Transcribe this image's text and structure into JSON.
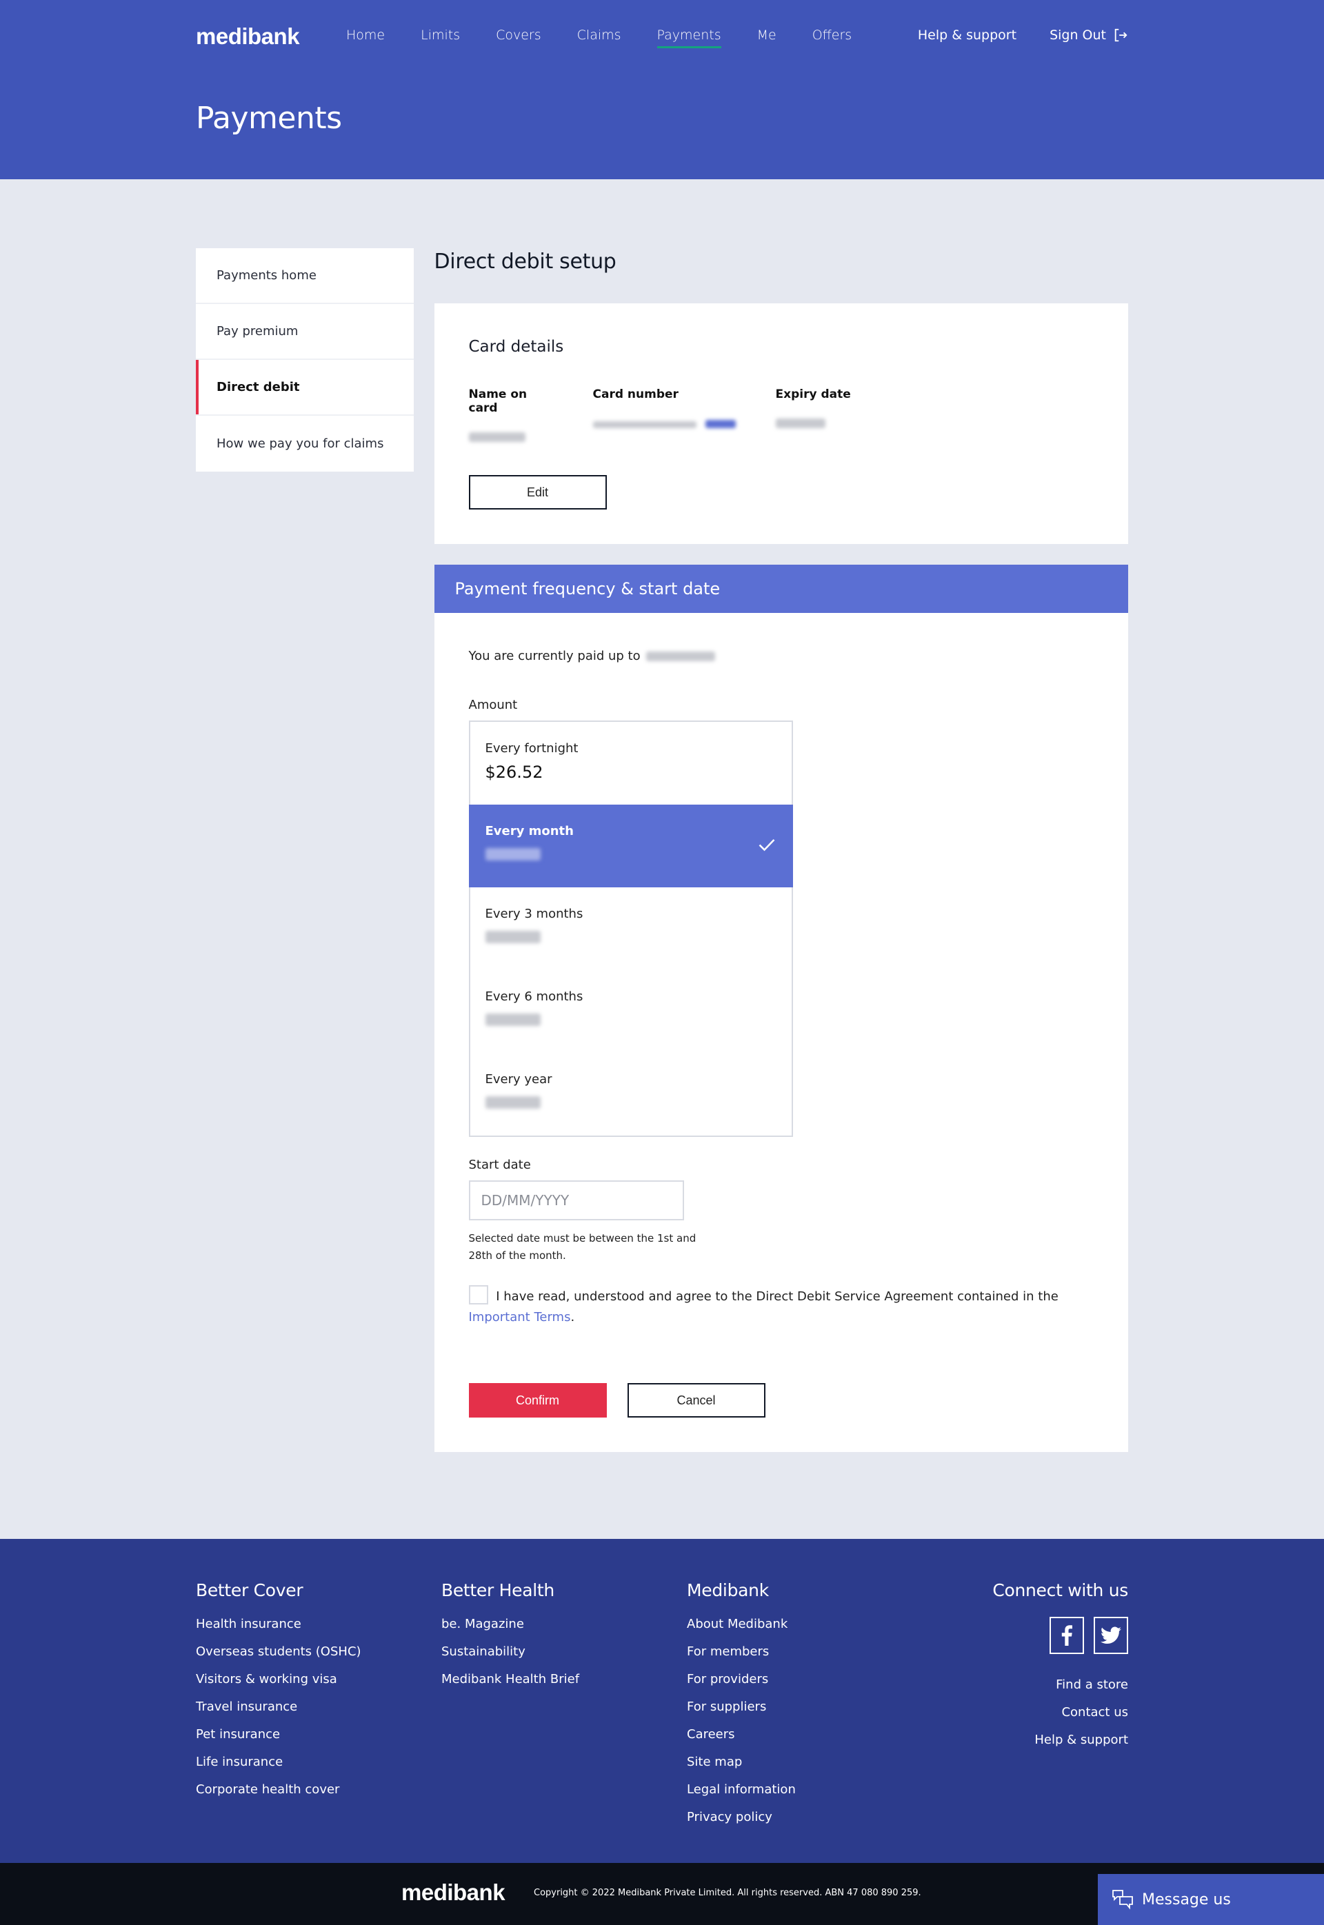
{
  "header": {
    "logo": "medibank",
    "nav": [
      {
        "label": "Home"
      },
      {
        "label": "Limits"
      },
      {
        "label": "Covers"
      },
      {
        "label": "Claims"
      },
      {
        "label": "Payments",
        "active": true
      },
      {
        "label": "Me"
      },
      {
        "label": "Offers"
      }
    ],
    "help_label": "Help & support",
    "signout_label": "Sign Out",
    "page_title": "Payments",
    "accent_color": "#15a37e"
  },
  "sidebar": {
    "items": [
      {
        "label": "Payments home"
      },
      {
        "label": "Pay premium"
      },
      {
        "label": "Direct debit",
        "active": true
      },
      {
        "label": "How we pay you for claims"
      }
    ]
  },
  "main": {
    "title": "Direct debit setup",
    "card_details": {
      "heading": "Card details",
      "name_label": "Name on card",
      "number_label": "Card number",
      "expiry_label": "Expiry date",
      "name_value": "[redacted]",
      "number_value": "[redacted]",
      "expiry_value": "[redacted]",
      "edit_label": "Edit"
    },
    "frequency": {
      "heading": "Payment frequency & start date",
      "paid_up_text": "You are currently paid up to",
      "paid_up_date": "[redacted]",
      "amount_label": "Amount",
      "options": [
        {
          "label": "Every fortnight",
          "amount": "$26.52",
          "selected": false
        },
        {
          "label": "Every month",
          "amount": "[redacted]",
          "selected": true
        },
        {
          "label": "Every 3 months",
          "amount": "[redacted]",
          "selected": false
        },
        {
          "label": "Every 6 months",
          "amount": "[redacted]",
          "selected": false
        },
        {
          "label": "Every year",
          "amount": "[redacted]",
          "selected": false
        }
      ],
      "start_date_label": "Start date",
      "start_date_placeholder": "DD/MM/YYYY",
      "start_date_value": "",
      "hint": "Selected date must be between the 1st and 28th of the month.",
      "agree_text": "I have read, understood and agree to the Direct Debit Service Agreement contained in the",
      "agree_link": "Important Terms",
      "agree_suffix": ".",
      "agree_checked": false,
      "confirm_label": "Confirm",
      "cancel_label": "Cancel"
    }
  },
  "footer": {
    "columns": [
      {
        "heading": "Better Cover",
        "links": [
          "Health insurance",
          "Overseas students (OSHC)",
          "Visitors & working visa",
          "Travel insurance",
          "Pet insurance",
          "Life insurance",
          "Corporate health cover"
        ]
      },
      {
        "heading": "Better Health",
        "links": [
          "be. Magazine",
          "Sustainability",
          "Medibank Health Brief"
        ]
      },
      {
        "heading": "Medibank",
        "links": [
          "About Medibank",
          "For members",
          "For providers",
          "For suppliers",
          "Careers",
          "Site map",
          "Legal information",
          "Privacy policy"
        ]
      }
    ],
    "connect": {
      "heading": "Connect with us",
      "socials": [
        "facebook-icon",
        "twitter-icon"
      ],
      "links": [
        "Find a store",
        "Contact us",
        "Help & support"
      ]
    },
    "bottom_logo": "medibank",
    "copyright": "Copyright © 2022 Medibank Private Limited. All rights reserved. ABN 47 080 890 259.",
    "message_label": "Message us"
  }
}
